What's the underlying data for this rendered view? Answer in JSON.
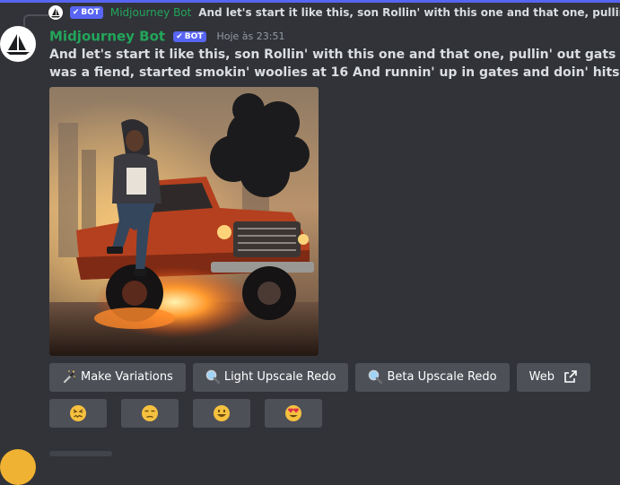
{
  "reply": {
    "author": "Midjourney Bot",
    "bot_tag": "BOT",
    "text": "And let's start it like this, son Rollin' with this one and that one, pullin' out gats for fun But"
  },
  "message": {
    "author": "Midjourney Bot",
    "bot_tag": "BOT",
    "timestamp": "Hoje às 23:51",
    "line1": "And let's start it like this, son Rollin' with this one and that one, pullin' out gats for fun But",
    "line2": "was a fiend, started smokin' woolies at 16 And runnin' up in gates and doin' hits for high sta"
  },
  "buttons": [
    {
      "label": "Make Variations",
      "icon": "magic-wand-icon"
    },
    {
      "label": "Light Upscale Redo",
      "icon": "magnifier-icon"
    },
    {
      "label": "Beta Upscale Redo",
      "icon": "magnifier-icon"
    },
    {
      "label": "Web",
      "icon": "external-link-icon"
    }
  ],
  "reactions": [
    {
      "emoji": "confounded-face",
      "icon": "confounded-face-icon"
    },
    {
      "emoji": "unamused-face",
      "icon": "unamused-face-icon"
    },
    {
      "emoji": "grinning-face",
      "icon": "grinning-face-icon"
    },
    {
      "emoji": "heart-eyes-face",
      "icon": "heart-eyes-face-icon"
    }
  ],
  "colors": {
    "background": "#313338",
    "accent": "#5865f2",
    "author": "#23a55a",
    "button": "#4e5058"
  }
}
